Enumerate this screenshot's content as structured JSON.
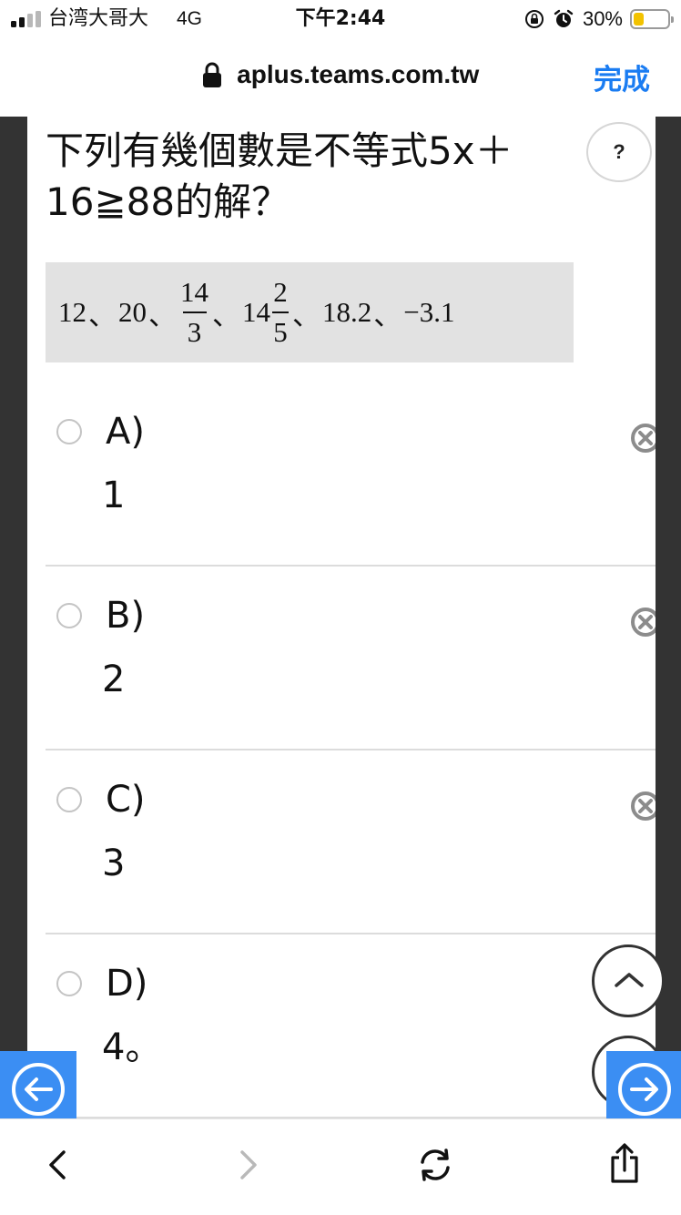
{
  "status_bar": {
    "carrier": "台湾大哥大",
    "network": "4G",
    "time": "下午2:44",
    "battery": "30%",
    "battery_level": 0.3,
    "battery_color": "#f2c200"
  },
  "browser": {
    "url": "aplus.teams.com.tw",
    "done_label": "完成"
  },
  "quiz": {
    "question": "下列有幾個數是不等式5x＋16≧88的解？",
    "help_label": "?",
    "numbers": {
      "n1": "12",
      "n2": "20",
      "frac1_num": "14",
      "frac1_den": "3",
      "mixed_whole": "14",
      "frac2_num": "2",
      "frac2_den": "5",
      "n5": "18.2",
      "n6": "−3.1",
      "separator": "、"
    },
    "options": [
      {
        "letter": "A)",
        "value": "1"
      },
      {
        "letter": "B)",
        "value": "2"
      },
      {
        "letter": "C)",
        "value": "3"
      },
      {
        "letter": "D)",
        "value": "4。"
      }
    ]
  },
  "toolbar": {
    "icons": [
      "back-icon",
      "forward-icon",
      "reload-icon",
      "share-icon"
    ]
  },
  "colors": {
    "accent": "#1a7cf2",
    "nav_button": "#3b8ef3",
    "frame": "#333333"
  }
}
